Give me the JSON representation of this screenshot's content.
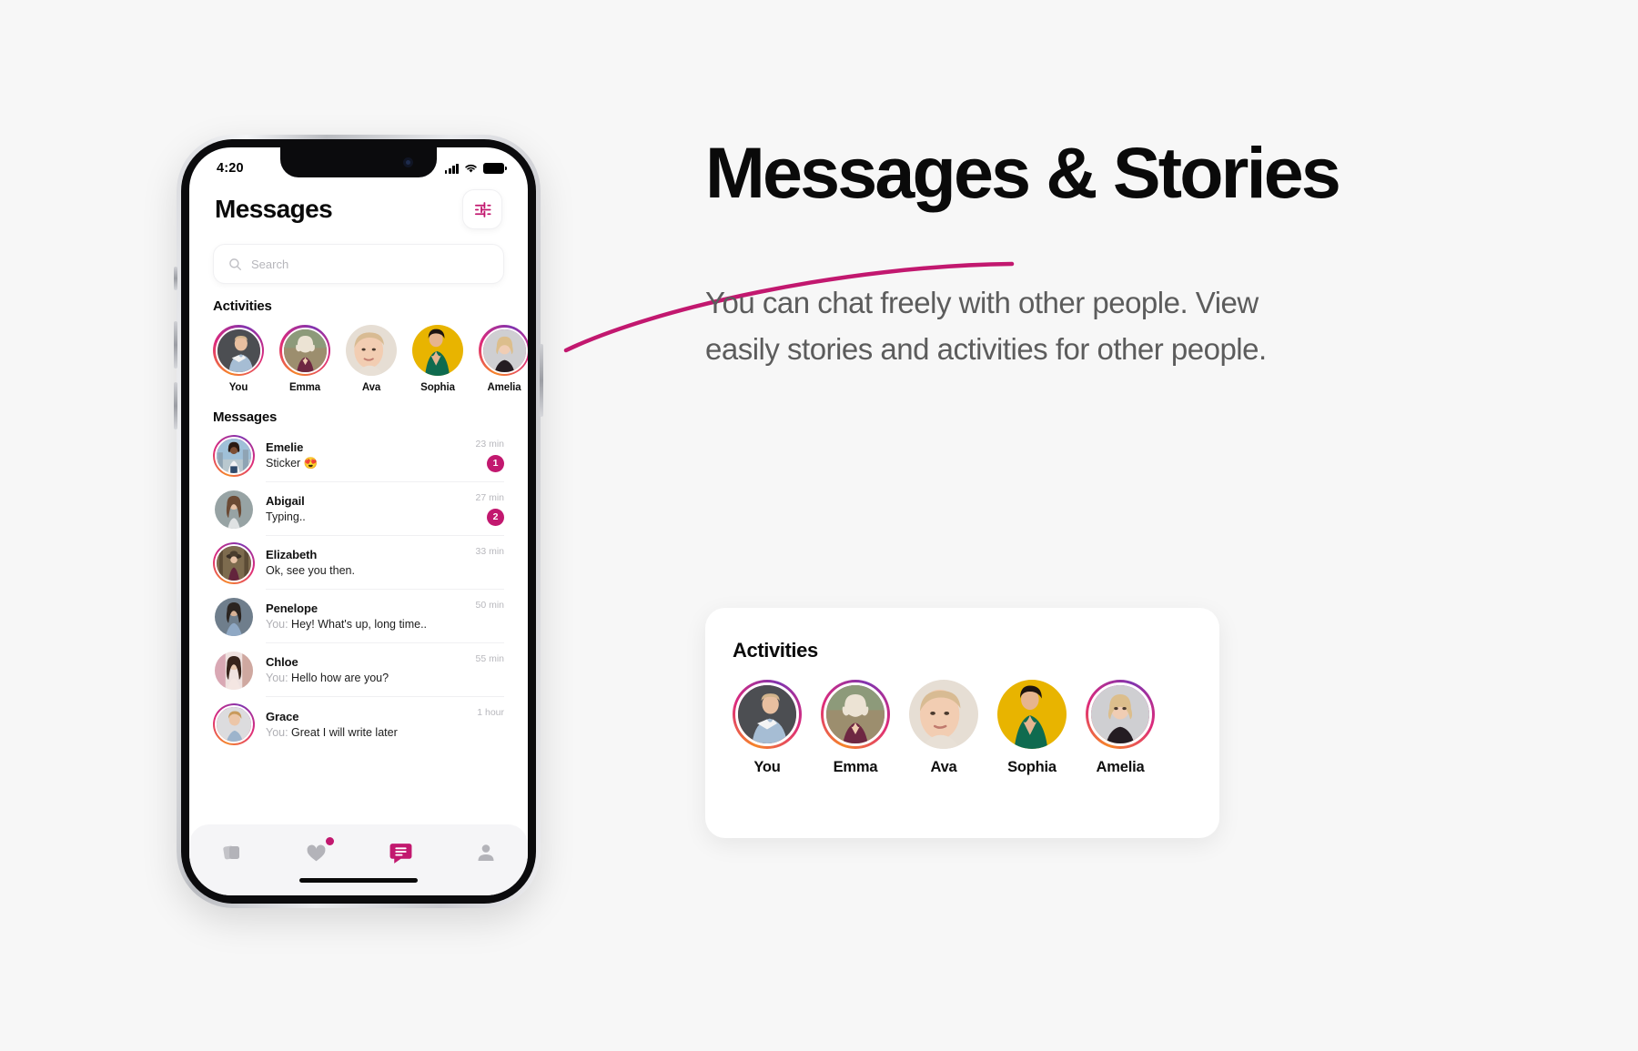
{
  "page": {
    "background_color": "#F7F7F7",
    "accent_color": "#C2186F",
    "story_ring_colors": [
      "#f58529",
      "#dd2a7b",
      "#8134af"
    ]
  },
  "headline": "Messages & Stories",
  "body_copy": "You can chat freely with other people. View easily stories and activities for other people.",
  "phone": {
    "status_bar": {
      "time": "4:20",
      "signal_icon": "cellular-signal-icon",
      "wifi_icon": "wifi-icon",
      "battery_icon": "battery-icon"
    },
    "header": {
      "title": "Messages",
      "filter_icon": "sliders-filter-icon"
    },
    "search": {
      "placeholder": "Search",
      "icon": "search-icon"
    },
    "activities_section": {
      "title": "Activities",
      "items": [
        {
          "name": "You",
          "has_story": true,
          "photo": "man-denim-jacket"
        },
        {
          "name": "Emma",
          "has_story": true,
          "photo": "blonde-woman-field"
        },
        {
          "name": "Ava",
          "has_story": false,
          "photo": "blonde-woman-portrait"
        },
        {
          "name": "Sophia",
          "has_story": false,
          "photo": "woman-green-dress-yellow-bg"
        },
        {
          "name": "Amelia",
          "has_story": true,
          "photo": "blonde-woman-black-top"
        }
      ]
    },
    "messages_section": {
      "title": "Messages",
      "items": [
        {
          "name": "Emelie",
          "preview": "Sticker 😍",
          "you_prefix": "",
          "time": "23 min",
          "badge": "1",
          "has_story": true,
          "photo": "woman-city-skyline"
        },
        {
          "name": "Abigail",
          "preview": "Typing..",
          "you_prefix": "",
          "time": "27 min",
          "badge": "2",
          "has_story": false,
          "photo": "woman-long-hair"
        },
        {
          "name": "Elizabeth",
          "preview": "Ok, see you then.",
          "you_prefix": "",
          "time": "33 min",
          "badge": "",
          "has_story": true,
          "photo": "woman-forest-hat"
        },
        {
          "name": "Penelope",
          "preview": "Hey! What's up, long time..",
          "you_prefix": "You: ",
          "time": "50 min",
          "badge": "",
          "has_story": false,
          "photo": "woman-blue-scarf"
        },
        {
          "name": "Chloe",
          "preview": "Hello how are you?",
          "you_prefix": "You: ",
          "time": "55 min",
          "badge": "",
          "has_story": false,
          "photo": "woman-pink-backdrop"
        },
        {
          "name": "Grace",
          "preview": "Great I will write later",
          "you_prefix": "You: ",
          "time": "1 hour",
          "badge": "",
          "has_story": true,
          "photo": "woman-short-hair-denim"
        }
      ]
    },
    "bottom_nav": {
      "items": [
        {
          "icon": "cards-stack-icon",
          "active": false,
          "has_dot": false
        },
        {
          "icon": "heart-icon",
          "active": false,
          "has_dot": true
        },
        {
          "icon": "chat-message-icon",
          "active": true,
          "has_dot": false
        },
        {
          "icon": "person-profile-icon",
          "active": false,
          "has_dot": false
        }
      ]
    }
  },
  "activities_card": {
    "title": "Activities",
    "items": [
      {
        "name": "You",
        "has_story": true,
        "photo": "man-denim-jacket"
      },
      {
        "name": "Emma",
        "has_story": true,
        "photo": "blonde-woman-field"
      },
      {
        "name": "Ava",
        "has_story": false,
        "photo": "blonde-woman-portrait"
      },
      {
        "name": "Sophia",
        "has_story": false,
        "photo": "woman-green-dress-yellow-bg"
      },
      {
        "name": "Amelia",
        "has_story": true,
        "photo": "blonde-woman-black-top"
      }
    ]
  }
}
